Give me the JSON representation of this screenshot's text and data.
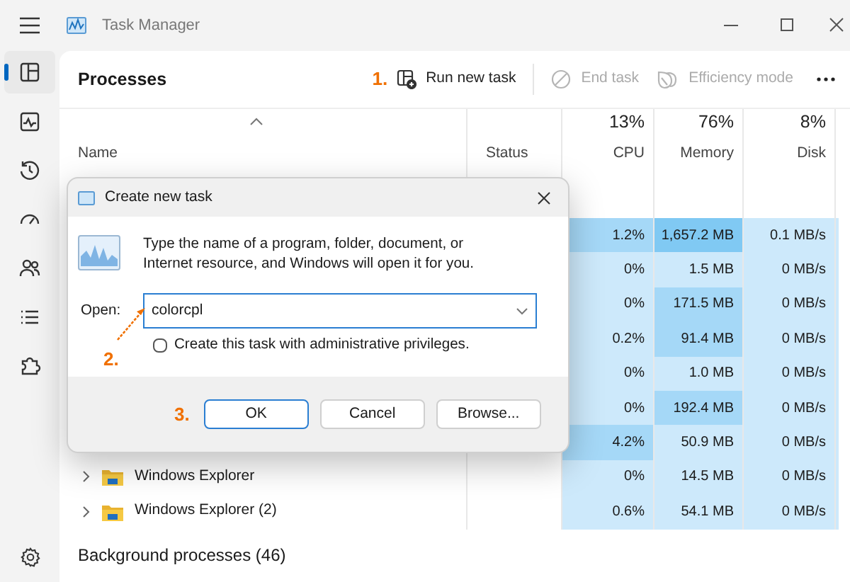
{
  "window": {
    "title": "Task Manager"
  },
  "sidebar": {
    "items": [
      {
        "kind": "processes",
        "selected": true
      },
      {
        "kind": "performance",
        "selected": false
      },
      {
        "kind": "history",
        "selected": false
      },
      {
        "kind": "startup",
        "selected": false
      },
      {
        "kind": "users",
        "selected": false
      },
      {
        "kind": "details",
        "selected": false
      },
      {
        "kind": "services",
        "selected": false
      }
    ]
  },
  "toolbar": {
    "title": "Processes",
    "step": "1.",
    "buttons": [
      {
        "kind": "run",
        "label": "Run new task",
        "disabled": false
      },
      {
        "kind": "end",
        "label": "End task",
        "disabled": true
      },
      {
        "kind": "efficiency",
        "label": "Efficiency mode",
        "disabled": true
      }
    ]
  },
  "table": {
    "columns": [
      {
        "label": "Name"
      },
      {
        "label": "Status"
      },
      {
        "percent": "13%",
        "label": "CPU"
      },
      {
        "percent": "76%",
        "label": "Memory"
      },
      {
        "percent": "8%",
        "label": "Disk"
      }
    ],
    "rows": [
      {
        "cells": [
          "",
          "",
          {
            "text": "1.2%",
            "color": "#a5d8f7"
          },
          {
            "text": "1,657.2 MB",
            "color": "#80c9f3"
          },
          {
            "text": "0.1 MB/s",
            "color": "#cde9fb"
          }
        ]
      },
      {
        "cells": [
          "",
          "",
          {
            "text": "0%",
            "color": "#cde9fb"
          },
          {
            "text": "1.5 MB",
            "color": "#cde9fb"
          },
          {
            "text": "0 MB/s",
            "color": "#cde9fb"
          }
        ]
      },
      {
        "cells": [
          "",
          "",
          {
            "text": "0%",
            "color": "#cde9fb"
          },
          {
            "text": "171.5 MB",
            "color": "#a5d8f7"
          },
          {
            "text": "0 MB/s",
            "color": "#cde9fb"
          }
        ]
      },
      {
        "cells": [
          "",
          "",
          {
            "text": "0.2%",
            "color": "#cde9fb"
          },
          {
            "text": "91.4 MB",
            "color": "#a5d8f7"
          },
          {
            "text": "0 MB/s",
            "color": "#cde9fb"
          }
        ]
      },
      {
        "cells": [
          "",
          "",
          {
            "text": "0%",
            "color": "#cde9fb"
          },
          {
            "text": "1.0 MB",
            "color": "#cde9fb"
          },
          {
            "text": "0 MB/s",
            "color": "#cde9fb"
          }
        ]
      },
      {
        "cells": [
          "",
          "",
          {
            "text": "0%",
            "color": "#cde9fb"
          },
          {
            "text": "192.4 MB",
            "color": "#a5d8f7"
          },
          {
            "text": "0 MB/s",
            "color": "#cde9fb"
          }
        ]
      },
      {
        "cells": [
          "",
          "",
          {
            "text": "4.2%",
            "color": "#a5d8f7"
          },
          {
            "text": "50.9 MB",
            "color": "#cde9fb"
          },
          {
            "text": "0 MB/s",
            "color": "#cde9fb"
          }
        ]
      },
      {
        "expanded": false,
        "cells": [
          "Windows Explorer",
          "",
          {
            "text": "0%",
            "color": "#cde9fb"
          },
          {
            "text": "14.5 MB",
            "color": "#cde9fb"
          },
          {
            "text": "0 MB/s",
            "color": "#cde9fb"
          }
        ]
      },
      {
        "expanded": false,
        "cells": [
          "Windows Explorer (2)",
          "",
          {
            "text": "0.6%",
            "color": "#cde9fb"
          },
          {
            "text": "54.1 MB",
            "color": "#cde9fb"
          },
          {
            "text": "0 MB/s",
            "color": "#cde9fb"
          }
        ]
      }
    ],
    "section": "Background processes (46)"
  },
  "dialog": {
    "title": "Create new task",
    "message": "Type the name of a program, folder, document, or Internet resource, and Windows will open it for you.",
    "open_label": "Open:",
    "value": "colorcpl",
    "step_field": "2.",
    "checkbox": {
      "label": "Create this task with administrative privileges.",
      "checked": false
    },
    "step_buttons": "3.",
    "buttons": [
      {
        "label": "OK",
        "selected": true
      },
      {
        "label": "Cancel",
        "selected": false
      },
      {
        "label": "Browse...",
        "selected": false
      }
    ]
  }
}
